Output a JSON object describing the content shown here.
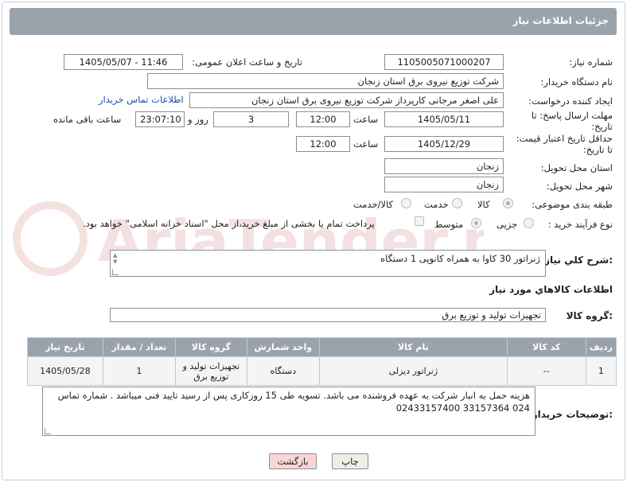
{
  "header": {
    "title": "جزئیات اطلاعات نیاز"
  },
  "fields": {
    "need_number_label": "شماره نیاز:",
    "need_number": "1105005071000207",
    "announce_label": "تاریخ و ساعت اعلان عمومی:",
    "announce_value": "1405/05/07 - 11:46",
    "buyer_org_label": "نام دستگاه خریدار:",
    "buyer_org": "شرکت توزیع نیروی برق استان زنجان",
    "requester_label": "ایجاد کننده درخواست:",
    "requester": "علی اصغر مرجانی کارپرداز شرکت توزیع نیروی برق استان زنجان",
    "contact_link": "اطلاعات تماس خریدار",
    "deadline_label_1": "مهلت ارسال پاسخ: تا",
    "deadline_label_2": "تاریخ:",
    "deadline_date": "1405/05/11",
    "time_label": "ساعت",
    "deadline_time": "12:00",
    "days_value": "3",
    "days_label": "روز و",
    "remaining_value": "23:07:10",
    "remaining_label": "ساعت باقی مانده",
    "validity_label_1": "حداقل تاریخ اعتبار قیمت:",
    "validity_label_2": "تا تاریخ:",
    "validity_date": "1405/12/29",
    "validity_time": "12:00",
    "province_label": "استان محل تحویل:",
    "province": "زنجان",
    "city_label": "شهر محل تحویل:",
    "city": "زنجان",
    "category_label": "طبقه بندی موضوعی:",
    "category_options": [
      "کالا",
      "خدمت",
      "کالا/خدمت"
    ],
    "process_label": "نوع فرآیند خرید :",
    "process_options": [
      "جزیی",
      "متوسط"
    ],
    "payment_note": "پرداخت تمام یا بخشی از مبلغ خرید،از محل \"اسناد خزانه اسلامی\" خواهد بود.",
    "summary_label": "شرح کلي نياز:",
    "summary": "ژنراتور 30 کاوا  به همراه کانوپی        1 دستگاه",
    "goods_info_title": "اطلاعات کالاهاي مورد نياز",
    "goods_group_label": "گروه کالا:",
    "goods_group": "تجهیزات تولید و توزیع برق",
    "buyer_notes_label": "توضیحات خریدار:",
    "buyer_notes": "هزینه حمل به انبار شرکت به عهده فروشنده می باشد. تسویه  طی 15 روزکاری  پس از رسید تایید فنی میباشد . شماره تماس  024  33157364         02433157400"
  },
  "table": {
    "headers": [
      "ردیف",
      "کد کالا",
      "نام کالا",
      "واحد شمارش",
      "گروه کالا",
      "تعداد / مقدار",
      "تاریخ نیاز"
    ],
    "rows": [
      [
        "1",
        "--",
        "ژنراتور دیزلی",
        "دستگاه",
        "تجهیزات تولید و توزیع برق",
        "1",
        "1405/05/28"
      ]
    ]
  },
  "buttons": {
    "print": "چاپ",
    "back": "بازگشت"
  },
  "watermark": "AriaTender.neT",
  "colors": {
    "header_bg": "#9aa3ac",
    "link": "#1a4fa8",
    "back_button": "#f8d6d6",
    "print_button": "#ecefe6"
  }
}
